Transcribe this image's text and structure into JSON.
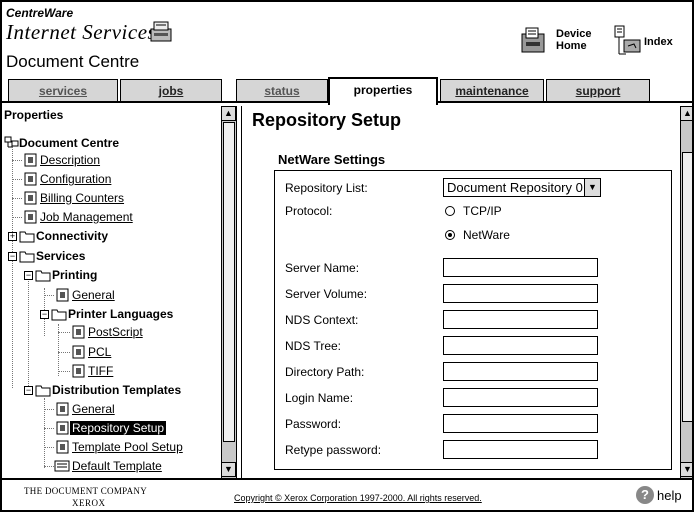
{
  "header": {
    "brand_line1": "CentreWare",
    "brand_line2": "Internet Services",
    "title": "Document Centre",
    "device_home_line1": "Device",
    "device_home_line2": "Home",
    "index_label": "Index"
  },
  "tabs": [
    {
      "label": "services"
    },
    {
      "label": "jobs"
    },
    {
      "label": "status"
    },
    {
      "label": "properties"
    },
    {
      "label": "maintenance"
    },
    {
      "label": "support"
    }
  ],
  "active_tab": "properties",
  "tree": {
    "heading": "Properties",
    "root": "Document Centre",
    "description": "Description",
    "configuration": "Configuration",
    "billing_counters": "Billing Counters",
    "job_management": "Job Management",
    "connectivity": "Connectivity",
    "services": "Services",
    "printing": "Printing",
    "printing_general": "General",
    "printer_languages": "Printer Languages",
    "postscript": "PostScript",
    "pcl": "PCL",
    "tiff": "TIFF",
    "distribution_templates": "Distribution Templates",
    "dist_general": "General",
    "repository_setup": "Repository Setup",
    "template_pool_setup": "Template Pool Setup",
    "default_template": "Default Template"
  },
  "content": {
    "title": "Repository Setup",
    "section": "NetWare Settings",
    "repository_list_label": "Repository List:",
    "repository_list_value": "Document Repository 0",
    "protocol_label": "Protocol:",
    "protocol_option_tcpip": "TCP/IP",
    "protocol_option_netware": "NetWare",
    "protocol_selected": "NetWare",
    "server_name_label": "Server Name:",
    "server_name_value": "",
    "server_volume_label": "Server Volume:",
    "server_volume_value": "",
    "nds_context_label": "NDS Context:",
    "nds_context_value": "",
    "nds_tree_label": "NDS Tree:",
    "nds_tree_value": "",
    "directory_path_label": "Directory Path:",
    "directory_path_value": "",
    "login_name_label": "Login Name:",
    "login_name_value": "",
    "password_label": "Password:",
    "password_value": "",
    "retype_password_label": "Retype password:",
    "retype_password_value": ""
  },
  "footer": {
    "company_line1": "THE DOCUMENT COMPANY",
    "company_line2": "XEROX",
    "copyright": "Copyright © Xerox Corporation 1997-2000. All rights reserved.",
    "help": "help"
  }
}
